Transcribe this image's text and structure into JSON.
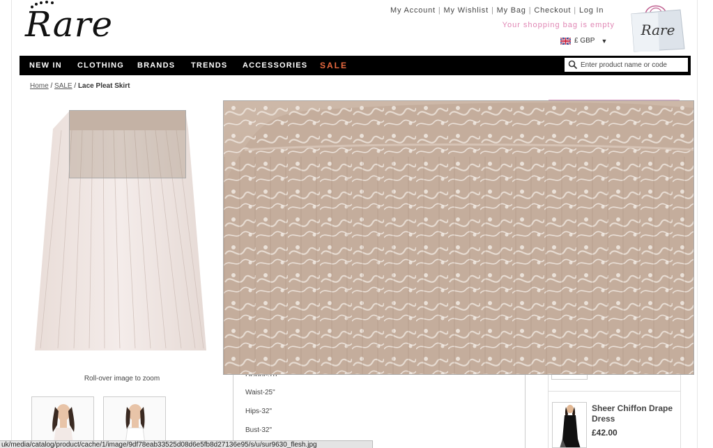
{
  "brand": {
    "logo_text": "Rare"
  },
  "header": {
    "links": [
      "My Account",
      "My Wishlist",
      "My Bag",
      "Checkout",
      "Log In"
    ],
    "bag_status": "Your shopping bag is empty",
    "currency": "£ GBP",
    "bag_logo_text": "Rare"
  },
  "nav": {
    "items": [
      "NEW IN",
      "CLOTHING",
      "BRANDS",
      "TRENDS",
      "ACCESSORIES",
      "SALE"
    ]
  },
  "search": {
    "placeholder": "Enter product name or code"
  },
  "breadcrumb": {
    "home": "Home",
    "sale": "SALE",
    "current": "Lace Pleat Skirt"
  },
  "product": {
    "zoom_hint": "Roll-over image to zoom",
    "details": [
      "Height-5'8\"",
      "Waist-25\"",
      "Hips-32\"",
      "Bust-32\""
    ]
  },
  "related": {
    "name": "Sheer Chiffon Drape Dress",
    "price": "£42.00"
  },
  "statusbar": {
    "url": "uk/media/catalog/product/cache/1/image/9df78eab33525d08d6e5fb8d27136e95/s/u/sur9630_flesh.jpg"
  },
  "colors": {
    "nav_bg": "#000000",
    "sale": "#e8693f",
    "bag_status": "#e086b4",
    "accent_line": "#e0a0c8"
  }
}
